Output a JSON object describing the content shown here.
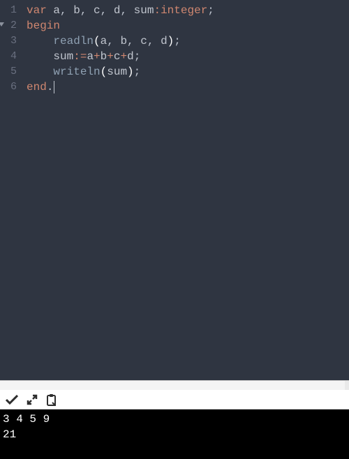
{
  "editor": {
    "lines": [
      {
        "num": 1,
        "fold": false,
        "tokens": [
          {
            "t": "var ",
            "c": "kw"
          },
          {
            "t": "a",
            "c": "id"
          },
          {
            "t": ", ",
            "c": "punct"
          },
          {
            "t": "b",
            "c": "id"
          },
          {
            "t": ", ",
            "c": "punct"
          },
          {
            "t": "c",
            "c": "id"
          },
          {
            "t": ", ",
            "c": "punct"
          },
          {
            "t": "d",
            "c": "id"
          },
          {
            "t": ", ",
            "c": "punct"
          },
          {
            "t": "sum",
            "c": "id"
          },
          {
            "t": ":",
            "c": "op"
          },
          {
            "t": "integer",
            "c": "type"
          },
          {
            "t": ";",
            "c": "punct"
          }
        ]
      },
      {
        "num": 2,
        "fold": true,
        "tokens": [
          {
            "t": "begin",
            "c": "kw"
          }
        ]
      },
      {
        "num": 3,
        "fold": false,
        "tokens": [
          {
            "t": "    ",
            "c": "id"
          },
          {
            "t": "readln",
            "c": "fn"
          },
          {
            "t": "(",
            "c": "white"
          },
          {
            "t": "a",
            "c": "id"
          },
          {
            "t": ", ",
            "c": "punct"
          },
          {
            "t": "b",
            "c": "id"
          },
          {
            "t": ", ",
            "c": "punct"
          },
          {
            "t": "c",
            "c": "id"
          },
          {
            "t": ", ",
            "c": "punct"
          },
          {
            "t": "d",
            "c": "id"
          },
          {
            "t": ")",
            "c": "white"
          },
          {
            "t": ";",
            "c": "punct"
          }
        ]
      },
      {
        "num": 4,
        "fold": false,
        "tokens": [
          {
            "t": "    ",
            "c": "id"
          },
          {
            "t": "sum",
            "c": "id"
          },
          {
            "t": ":",
            "c": "op"
          },
          {
            "t": "=",
            "c": "op"
          },
          {
            "t": "a",
            "c": "id"
          },
          {
            "t": "+",
            "c": "op"
          },
          {
            "t": "b",
            "c": "id"
          },
          {
            "t": "+",
            "c": "op"
          },
          {
            "t": "c",
            "c": "id"
          },
          {
            "t": "+",
            "c": "op"
          },
          {
            "t": "d",
            "c": "id"
          },
          {
            "t": ";",
            "c": "punct"
          }
        ]
      },
      {
        "num": 5,
        "fold": false,
        "tokens": [
          {
            "t": "    ",
            "c": "id"
          },
          {
            "t": "writeln",
            "c": "fn"
          },
          {
            "t": "(",
            "c": "white"
          },
          {
            "t": "sum",
            "c": "id"
          },
          {
            "t": ")",
            "c": "white"
          },
          {
            "t": ";",
            "c": "punct"
          }
        ]
      },
      {
        "num": 6,
        "fold": false,
        "cursor": true,
        "tokens": [
          {
            "t": "end",
            "c": "kw"
          },
          {
            "t": ".",
            "c": "punct"
          }
        ]
      }
    ]
  },
  "toolbar": {
    "accept_title": "Accept",
    "expand_title": "Expand",
    "copy_title": "Copy input"
  },
  "console": {
    "input": "3 4 5 9",
    "output": "21"
  }
}
